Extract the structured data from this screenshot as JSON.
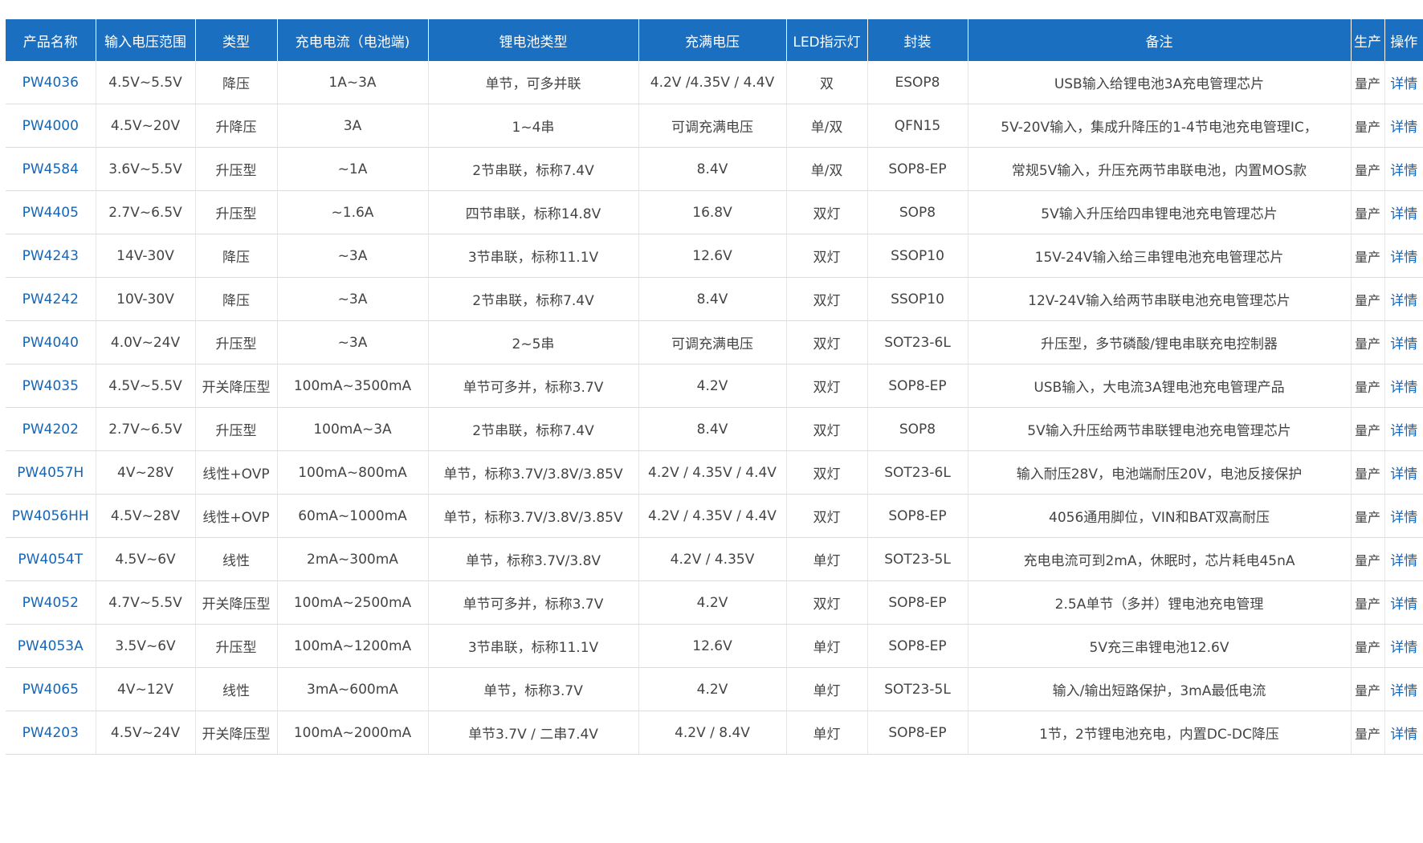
{
  "table": {
    "headers": [
      "产品名称",
      "输入电压范围",
      "类型",
      "充电电流（电池端)",
      "锂电池类型",
      "充满电压",
      "LED指示灯",
      "封装",
      "备注",
      "生产",
      "操作"
    ],
    "rows": [
      {
        "name": "PW4036",
        "vin": "4.5V~5.5V",
        "type": "降压",
        "current": "1A~3A",
        "battery": "单节，可多并联",
        "full": "4.2V /4.35V / 4.4V",
        "led": "双",
        "pkg": "ESOP8",
        "note": "USB输入给锂电池3A充电管理芯片",
        "status": "量产",
        "action": "详情"
      },
      {
        "name": "PW4000",
        "vin": "4.5V~20V",
        "type": "升降压",
        "current": "3A",
        "battery": "1~4串",
        "full": "可调充满电压",
        "led": "单/双",
        "pkg": "QFN15",
        "note": "5V-20V输入，集成升降压的1-4节电池充电管理IC，",
        "status": "量产",
        "action": "详情"
      },
      {
        "name": "PW4584",
        "vin": "3.6V~5.5V",
        "type": "升压型",
        "current": "~1A",
        "battery": "2节串联，标称7.4V",
        "full": "8.4V",
        "led": "单/双",
        "pkg": "SOP8-EP",
        "note": "常规5V输入，升压充两节串联电池，内置MOS款",
        "status": "量产",
        "action": "详情"
      },
      {
        "name": "PW4405",
        "vin": "2.7V~6.5V",
        "type": "升压型",
        "current": "~1.6A",
        "battery": "四节串联，标称14.8V",
        "full": "16.8V",
        "led": "双灯",
        "pkg": "SOP8",
        "note": "5V输入升压给四串锂电池充电管理芯片",
        "status": "量产",
        "action": "详情"
      },
      {
        "name": "PW4243",
        "vin": "14V-30V",
        "type": "降压",
        "current": "~3A",
        "battery": "3节串联，标称11.1V",
        "full": "12.6V",
        "led": "双灯",
        "pkg": "SSOP10",
        "note": "15V-24V输入给三串锂电池充电管理芯片",
        "status": "量产",
        "action": "详情"
      },
      {
        "name": "PW4242",
        "vin": "10V-30V",
        "type": "降压",
        "current": "~3A",
        "battery": "2节串联，标称7.4V",
        "full": "8.4V",
        "led": "双灯",
        "pkg": "SSOP10",
        "note": "12V-24V输入给两节串联电池充电管理芯片",
        "status": "量产",
        "action": "详情"
      },
      {
        "name": "PW4040",
        "vin": "4.0V~24V",
        "type": "升压型",
        "current": "~3A",
        "battery": "2~5串",
        "full": "可调充满电压",
        "led": "双灯",
        "pkg": "SOT23-6L",
        "note": "升压型，多节磷酸/锂电串联充电控制器",
        "status": "量产",
        "action": "详情"
      },
      {
        "name": "PW4035",
        "vin": "4.5V~5.5V",
        "type": "开关降压型",
        "current": "100mA~3500mA",
        "battery": "单节可多并，标称3.7V",
        "full": "4.2V",
        "led": "双灯",
        "pkg": "SOP8-EP",
        "note": "USB输入，大电流3A锂电池充电管理产品",
        "status": "量产",
        "action": "详情"
      },
      {
        "name": "PW4202",
        "vin": "2.7V~6.5V",
        "type": "升压型",
        "current": "100mA~3A",
        "battery": "2节串联，标称7.4V",
        "full": "8.4V",
        "led": "双灯",
        "pkg": "SOP8",
        "note": "5V输入升压给两节串联锂电池充电管理芯片",
        "status": "量产",
        "action": "详情"
      },
      {
        "name": "PW4057H",
        "vin": "4V~28V",
        "type": "线性+OVP",
        "current": "100mA~800mA",
        "battery": "单节，标称3.7V/3.8V/3.85V",
        "full": "4.2V / 4.35V / 4.4V",
        "led": "双灯",
        "pkg": "SOT23-6L",
        "note": "输入耐压28V，电池端耐压20V，电池反接保护",
        "status": "量产",
        "action": "详情"
      },
      {
        "name": "PW4056HH",
        "vin": "4.5V~28V",
        "type": "线性+OVP",
        "current": "60mA~1000mA",
        "battery": "单节，标称3.7V/3.8V/3.85V",
        "full": "4.2V / 4.35V / 4.4V",
        "led": "双灯",
        "pkg": "SOP8-EP",
        "note": "4056通用脚位，VIN和BAT双高耐压",
        "status": "量产",
        "action": "详情"
      },
      {
        "name": "PW4054T",
        "vin": "4.5V~6V",
        "type": "线性",
        "current": "2mA~300mA",
        "battery": "单节，标称3.7V/3.8V",
        "full": "4.2V / 4.35V",
        "led": "单灯",
        "pkg": "SOT23-5L",
        "note": "充电电流可到2mA，休眠时，芯片耗电45nA",
        "status": "量产",
        "action": "详情"
      },
      {
        "name": "PW4052",
        "vin": "4.7V~5.5V",
        "type": "开关降压型",
        "current": "100mA~2500mA",
        "battery": "单节可多并，标称3.7V",
        "full": "4.2V",
        "led": "双灯",
        "pkg": "SOP8-EP",
        "note": "2.5A单节（多并）锂电池充电管理",
        "status": "量产",
        "action": "详情"
      },
      {
        "name": "PW4053A",
        "vin": "3.5V~6V",
        "type": "升压型",
        "current": "100mA~1200mA",
        "battery": "3节串联，标称11.1V",
        "full": "12.6V",
        "led": "单灯",
        "pkg": "SOP8-EP",
        "note": "5V充三串锂电池12.6V",
        "status": "量产",
        "action": "详情"
      },
      {
        "name": "PW4065",
        "vin": "4V~12V",
        "type": "线性",
        "current": "3mA~600mA",
        "battery": "单节，标称3.7V",
        "full": "4.2V",
        "led": "单灯",
        "pkg": "SOT23-5L",
        "note": "输入/输出短路保护，3mA最低电流",
        "status": "量产",
        "action": "详情"
      },
      {
        "name": "PW4203",
        "vin": "4.5V~24V",
        "type": "开关降压型",
        "current": "100mA~2000mA",
        "battery": "单节3.7V / 二串7.4V",
        "full": "4.2V / 8.4V",
        "led": "单灯",
        "pkg": "SOP8-EP",
        "note": "1节，2节锂电池充电，内置DC-DC降压",
        "status": "量产",
        "action": "详情"
      }
    ]
  }
}
